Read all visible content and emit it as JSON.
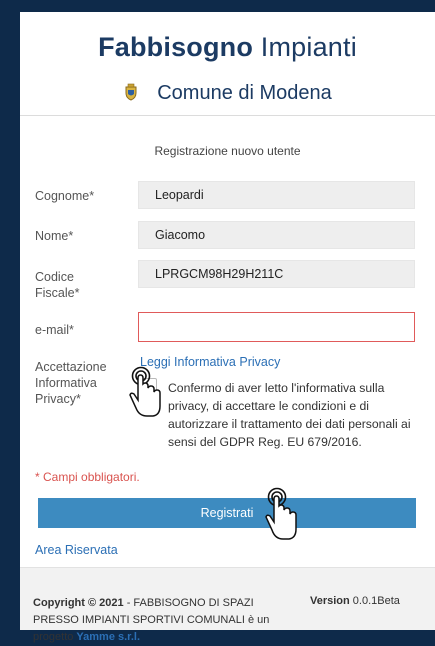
{
  "header": {
    "title_bold": "Fabbisogno",
    "title_light": "Impianti",
    "municipality": "Comune di Modena"
  },
  "form": {
    "title": "Registrazione nuovo utente",
    "fields": {
      "cognome": {
        "label": "Cognome*",
        "value": "Leopardi"
      },
      "nome": {
        "label": "Nome*",
        "value": "Giacomo"
      },
      "codice_fiscale": {
        "label_line1": "Codice",
        "label_line2": "Fiscale*",
        "value": "LPRGCM98H29H211C"
      },
      "email": {
        "label": "e-mail*",
        "value": ""
      }
    },
    "privacy": {
      "label_line1": "Accettazione",
      "label_line2": "Informativa",
      "label_line3": "Privacy*",
      "link": "Leggi Informativa Privacy",
      "consent": "Confermo di aver letto l'informativa sulla privacy, di accettare le condizioni e di autorizzare il trattamento dei dati personali ai sensi del GDPR Reg. EU 679/2016."
    },
    "required_note": "* Campi obbligatori.",
    "submit_label": "Registrati",
    "reserved_area": "Area Riservata"
  },
  "footer": {
    "copyright_prefix": "Copyright © 2021",
    "copyright_text": " - FABBISOGNO DI SPAZI PRESSO IMPIANTI SPORTIVI COMUNALI è un progetto ",
    "brand": "Yamme s.r.l.",
    "version_label": "Version",
    "version_value": " 0.0.1Beta"
  },
  "colors": {
    "outer_background": "#0e2a4a",
    "title": "#1c3b63",
    "link": "#2b6fb5",
    "button": "#3d8bc0",
    "error": "#d9534f"
  },
  "icons": [
    "coat-of-arms-icon",
    "pointer-hand-icon"
  ]
}
